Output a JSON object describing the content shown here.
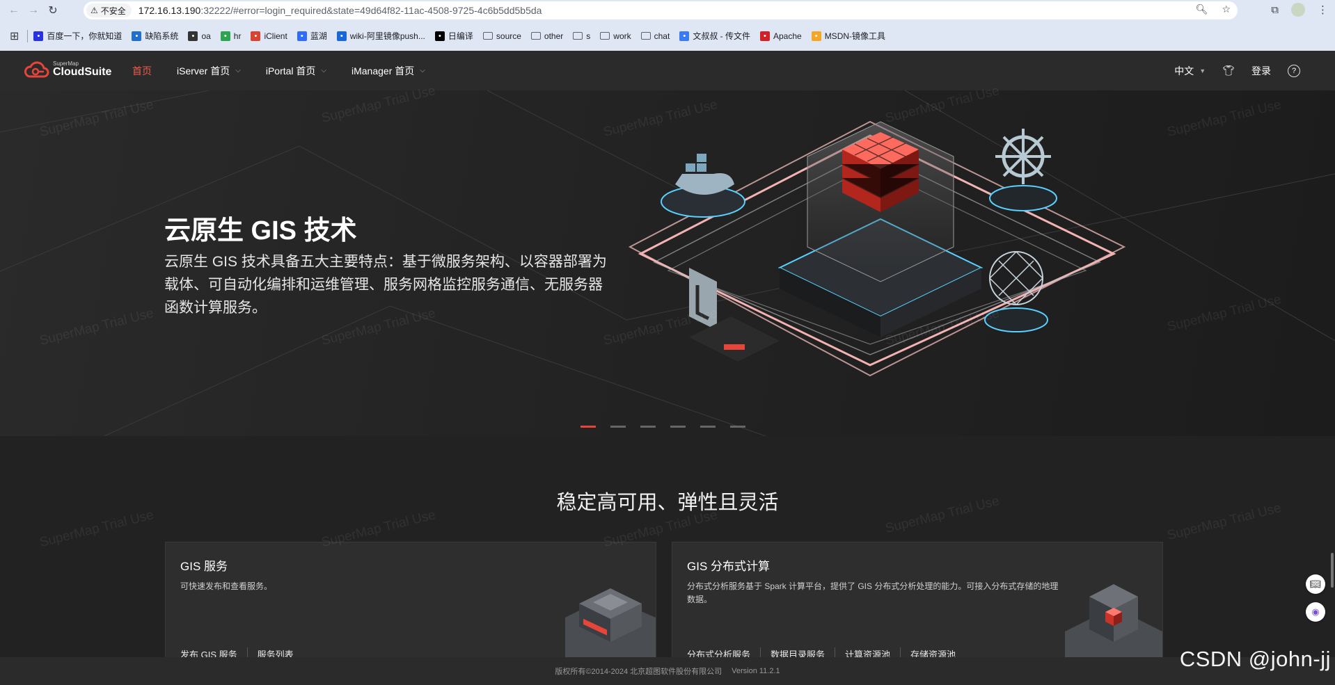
{
  "browser": {
    "security_label": "不安全",
    "url_host": "172.16.13.190",
    "url_rest": ":32222/#error=login_required&state=49d64f82-11ac-4508-9725-4c6b5dd5b5da"
  },
  "bookmarks": [
    {
      "label": "百度一下，你就知道",
      "icon": "baidu-icon",
      "color": "#2932e1"
    },
    {
      "label": "缺陷系统",
      "icon": "bug-system-icon",
      "color": "#1f6fd1"
    },
    {
      "label": "oa",
      "icon": "oa-icon",
      "color": "#333333"
    },
    {
      "label": "hr",
      "icon": "hr-icon",
      "color": "#2da44e"
    },
    {
      "label": "iClient",
      "icon": "iclient-icon",
      "color": "#d9432f"
    },
    {
      "label": "蓝湖",
      "icon": "lanhu-icon",
      "color": "#2f6bff"
    },
    {
      "label": "wiki-阿里镜像push...",
      "icon": "confluence-icon",
      "color": "#1868db"
    },
    {
      "label": "日编译",
      "icon": "teamcity-icon",
      "color": "#000000"
    },
    {
      "label": "source",
      "icon": "folder-icon"
    },
    {
      "label": "other",
      "icon": "folder-icon"
    },
    {
      "label": "s",
      "icon": "folder-icon"
    },
    {
      "label": "work",
      "icon": "folder-icon"
    },
    {
      "label": "chat",
      "icon": "folder-icon"
    },
    {
      "label": "文叔叔 - 传文件",
      "icon": "wenshushu-icon",
      "color": "#3b7cf5"
    },
    {
      "label": "Apache",
      "icon": "apache-feather-icon",
      "color": "#d22128"
    },
    {
      "label": "MSDN-镜像工具",
      "icon": "msdn-icon",
      "color": "#f5a623"
    }
  ],
  "app": {
    "logo_small": "SuperMap",
    "logo_big": "CloudSuite",
    "nav": [
      {
        "label": "首页",
        "active": true,
        "dropdown": false
      },
      {
        "label": "iServer 首页",
        "active": false,
        "dropdown": true
      },
      {
        "label": "iPortal 首页",
        "active": false,
        "dropdown": true
      },
      {
        "label": "iManager 首页",
        "active": false,
        "dropdown": true
      }
    ],
    "language": "中文",
    "login": "登录",
    "accent": "#f25a4a"
  },
  "hero": {
    "title": "云原生 GIS 技术",
    "description": "云原生 GIS 技术具备五大主要特点：基于微服务架构、以容器部署为载体、可自动化编排和运维管理、服务网格监控服务通信、无服务器函数计算服务。",
    "slide_count": 6,
    "active_slide": 1
  },
  "watermark": "SuperMap Trial Use",
  "section": {
    "title": "稳定高可用、弹性且灵活",
    "cards": [
      {
        "title": "GIS 服务",
        "description": "可快速发布和查看服务。",
        "links": [
          "发布 GIS 服务",
          "服务列表"
        ]
      },
      {
        "title": "GIS 分布式计算",
        "description": "分布式分析服务基于 Spark 计算平台，提供了 GIS 分布式分析处理的能力。可接入分布式存储的地理数据。",
        "links": [
          "分布式分析服务",
          "数据目录服务",
          "计算资源池",
          "存储资源池"
        ]
      }
    ]
  },
  "footer": {
    "copyright": "版权所有©2014-2024 北京超图软件股份有限公司",
    "version": "Version 11.2.1"
  },
  "overlay_text": "CSDN @john-jj"
}
